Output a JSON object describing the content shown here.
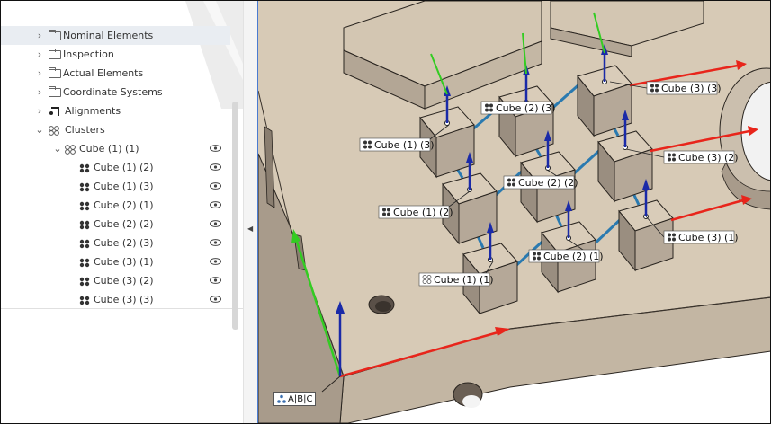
{
  "tree": {
    "items": [
      {
        "label": "Nominal Elements",
        "icon": "folder-icon",
        "chevron": "›"
      },
      {
        "label": "Inspection",
        "icon": "folder-icon",
        "chevron": "›"
      },
      {
        "label": "Actual Elements",
        "icon": "folder-icon",
        "chevron": "›"
      },
      {
        "label": "Coordinate Systems",
        "icon": "folder-icon",
        "chevron": "›"
      },
      {
        "label": "Alignments",
        "icon": "alignment-icon",
        "chevron": "›"
      },
      {
        "label": "Clusters",
        "icon": "clusters-icon",
        "chevron": "⌄"
      }
    ],
    "group": {
      "label": "Cube (1) (1)",
      "icon": "cluster-icon",
      "chevron": "⌄"
    },
    "children": [
      {
        "label": "Cube (1) (2)"
      },
      {
        "label": "Cube (1) (3)"
      },
      {
        "label": "Cube (2) (1)"
      },
      {
        "label": "Cube (2) (2)"
      },
      {
        "label": "Cube (2) (3)"
      },
      {
        "label": "Cube (3) (1)"
      },
      {
        "label": "Cube (3) (2)"
      },
      {
        "label": "Cube (3) (3)"
      }
    ]
  },
  "viewport": {
    "labels": {
      "c11": "Cube (1) (1)",
      "c12": "Cube (1) (2)",
      "c13": "Cube (1) (3)",
      "c21": "Cube (2) (1)",
      "c22": "Cube (2) (2)",
      "c23": "Cube (2) (3)",
      "c31": "Cube (3) (1)",
      "c32": "Cube (3) (2)",
      "c33": "Cube (3) (3)"
    },
    "coord_label": "A|B|C"
  },
  "colors": {
    "model_top": "#d9ccb9",
    "model_side": "#b5a898",
    "model_dark": "#9a8e80",
    "axis_x": "#e8251b",
    "axis_y": "#33cc22",
    "axis_z": "#1a2aa8",
    "connector": "#2a7ab0"
  }
}
